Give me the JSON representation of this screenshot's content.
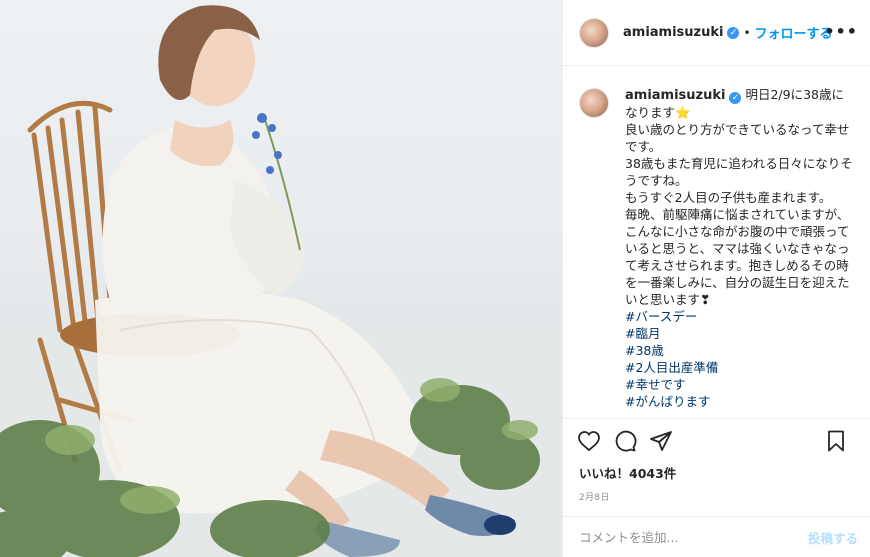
{
  "post": {
    "username": "amiamisuzuki",
    "follow_label": "フォローする",
    "dot": "•",
    "more": "•••"
  },
  "caption": {
    "username": "amiamisuzuki",
    "lines": [
      "明日2/9に38歳になります⭐",
      "良い歳のとり方ができているなって幸せです。",
      "38歳もまた育児に追われる日々になりそうですね。",
      "もうすぐ2人目の子供も産まれます。",
      "毎晩、前駆陣痛に悩まされていますが、こんなに小さな命がお腹の中で頑張っていると思うと、ママは強くいなきゃなって考えさせられます。抱きしめるその時を一番楽しみに、自分の誕生日を迎えたいと思います❣"
    ],
    "hashtags": [
      "#バースデー",
      "#臨月",
      "#38歳",
      "#2人目出産準備",
      "#幸せです",
      "#がんばります"
    ]
  },
  "engagement": {
    "likes_label": "いいね！4043件",
    "date": "2月8日"
  },
  "comment": {
    "placeholder": "コメントを追加...",
    "post_label": "投稿する"
  },
  "colors": {
    "accent": "#0095f6",
    "link": "#00376b",
    "post_disabled": "#b2dffc",
    "verified": "#3897f0"
  },
  "icons": [
    "heart-icon",
    "comment-icon",
    "share-icon",
    "bookmark-icon",
    "verified-badge-icon",
    "more-options-icon"
  ]
}
